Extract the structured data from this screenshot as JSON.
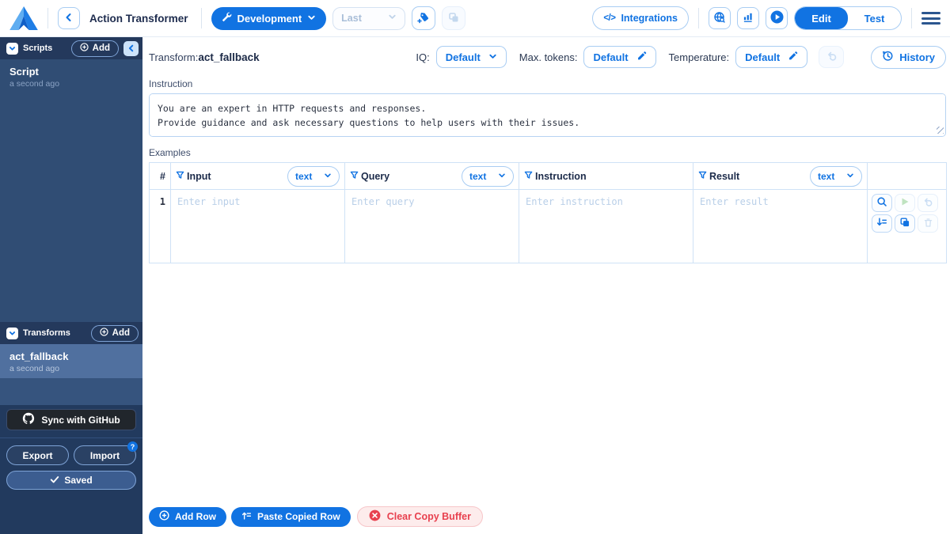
{
  "header": {
    "title": "Action Transformer",
    "development_button": "Development",
    "last_dropdown": "Last",
    "integrations_icon": "</>",
    "integrations_button": "Integrations",
    "edit_tab": "Edit",
    "test_tab": "Test"
  },
  "sidebar": {
    "scripts_title": "Scripts",
    "scripts_add": "Add",
    "script_name": "Script",
    "script_meta": "a second ago",
    "transforms_title": "Transforms",
    "transforms_add": "Add",
    "transform_name": "act_fallback",
    "transform_meta": "a second ago",
    "github_button": "Sync with GitHub",
    "export_button": "Export",
    "import_button": "Import",
    "import_badge": "?",
    "saved_button": "Saved"
  },
  "main": {
    "transform_label": "Transform:",
    "transform_name": "act_fallback",
    "iq": {
      "label": "IQ:",
      "value": "Default"
    },
    "max_tokens": {
      "label": "Max. tokens:",
      "value": "Default"
    },
    "temperature": {
      "label": "Temperature:",
      "value": "Default"
    },
    "history_button": "History",
    "instruction_label": "Instruction",
    "instruction_text": "You are an expert in HTTP requests and responses.\nProvide guidance and ask necessary questions to help users with their issues.",
    "examples_label": "Examples",
    "examples": {
      "columns": [
        {
          "label": "#"
        },
        {
          "label": "Input",
          "type": "text"
        },
        {
          "label": "Query",
          "type": "text"
        },
        {
          "label": "Instruction"
        },
        {
          "label": "Result",
          "type": "text"
        }
      ],
      "row": {
        "number": "1",
        "input_placeholder": "Enter input",
        "query_placeholder": "Enter query",
        "instruction_placeholder": "Enter instruction",
        "result_placeholder": "Enter result"
      }
    },
    "add_row_button": "Add Row",
    "paste_row_button": "Paste Copied Row",
    "clear_buffer_button": "Clear Copy Buffer"
  },
  "colors": {
    "accent_blue": "#1173e2",
    "sidebar_bg": "#304d74",
    "sidebar_header_bg": "#24395c",
    "sidebar_selected_bg": "#50709f",
    "sidebar_bottom_bg": "#223a5e",
    "github_button_bg": "#21262c",
    "danger_red": "#e8414f",
    "danger_bg": "#fdecec",
    "placeholder_blue": "#b9cfe8",
    "table_border": "#cfe2f6",
    "disabled_green": "#bfe3c0"
  }
}
